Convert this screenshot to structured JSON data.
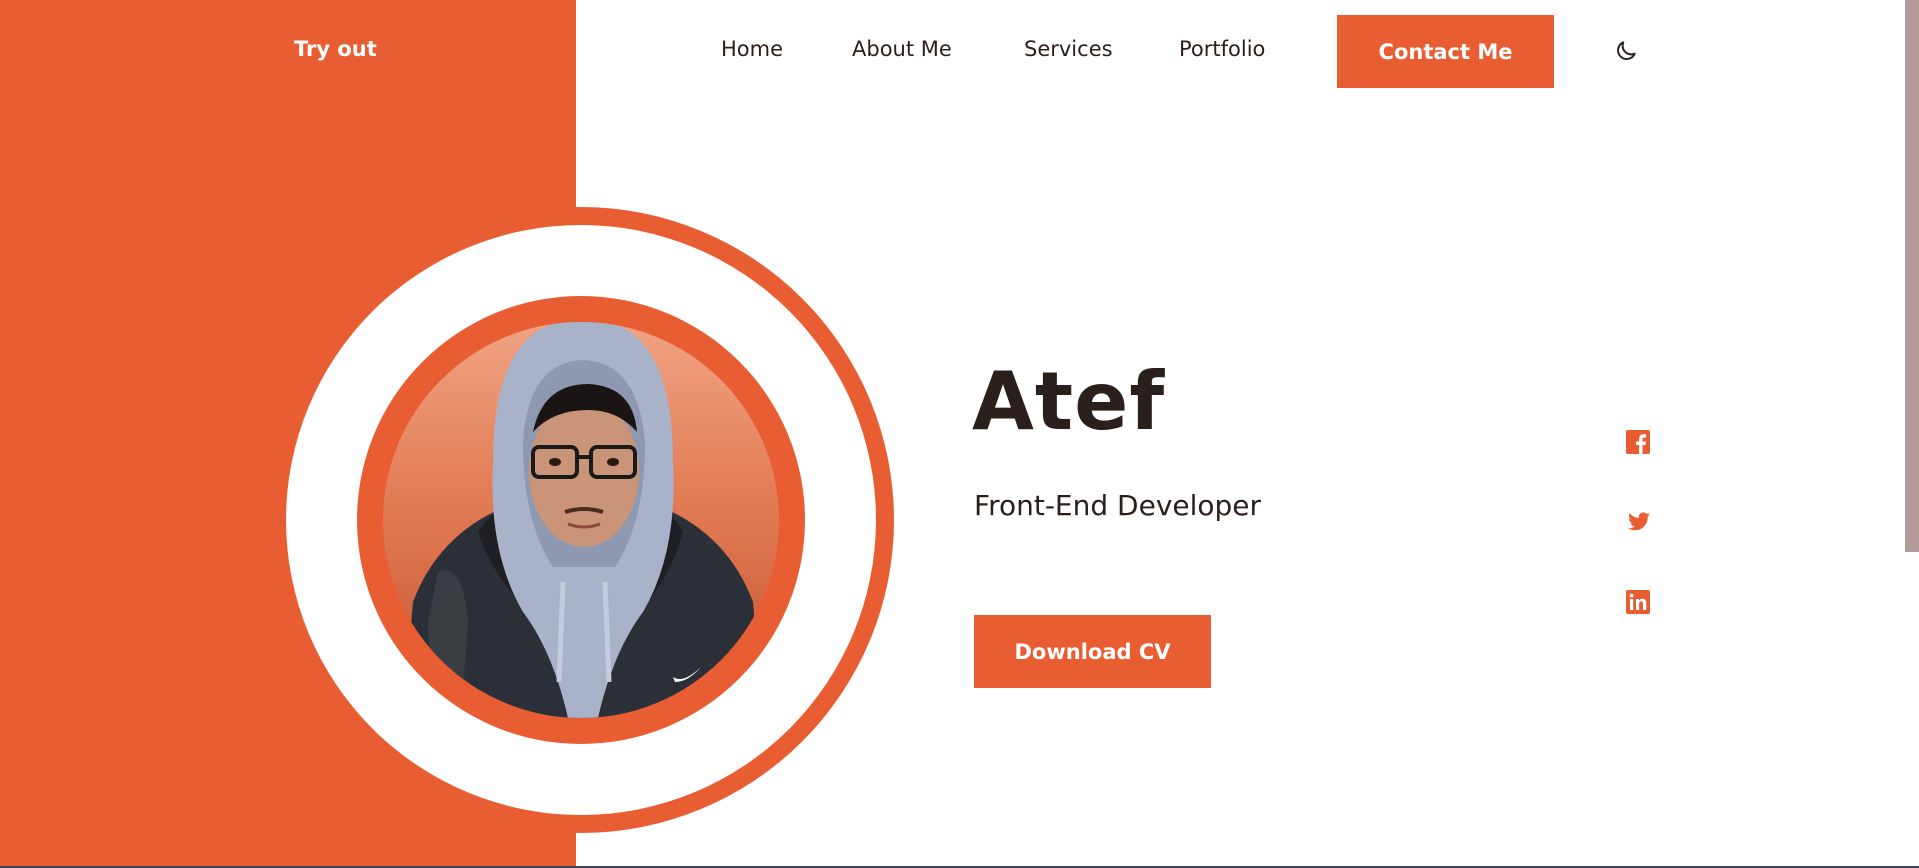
{
  "brand": {
    "logo_text": "Try out"
  },
  "nav": {
    "items": [
      {
        "label": "Home"
      },
      {
        "label": "About Me"
      },
      {
        "label": "Services"
      },
      {
        "label": "Portfolio"
      }
    ],
    "contact_label": "Contact Me",
    "theme_icon": "moon-icon"
  },
  "hero": {
    "name": "Atef",
    "role": "Front-End Developer",
    "cta_label": "Download CV",
    "photo_alt": "profile-photo"
  },
  "social": [
    {
      "icon": "facebook-icon"
    },
    {
      "icon": "twitter-icon"
    },
    {
      "icon": "linkedin-icon"
    }
  ],
  "colors": {
    "accent": "#e85e32",
    "text": "#2b1f1c",
    "background": "#ffffff"
  }
}
